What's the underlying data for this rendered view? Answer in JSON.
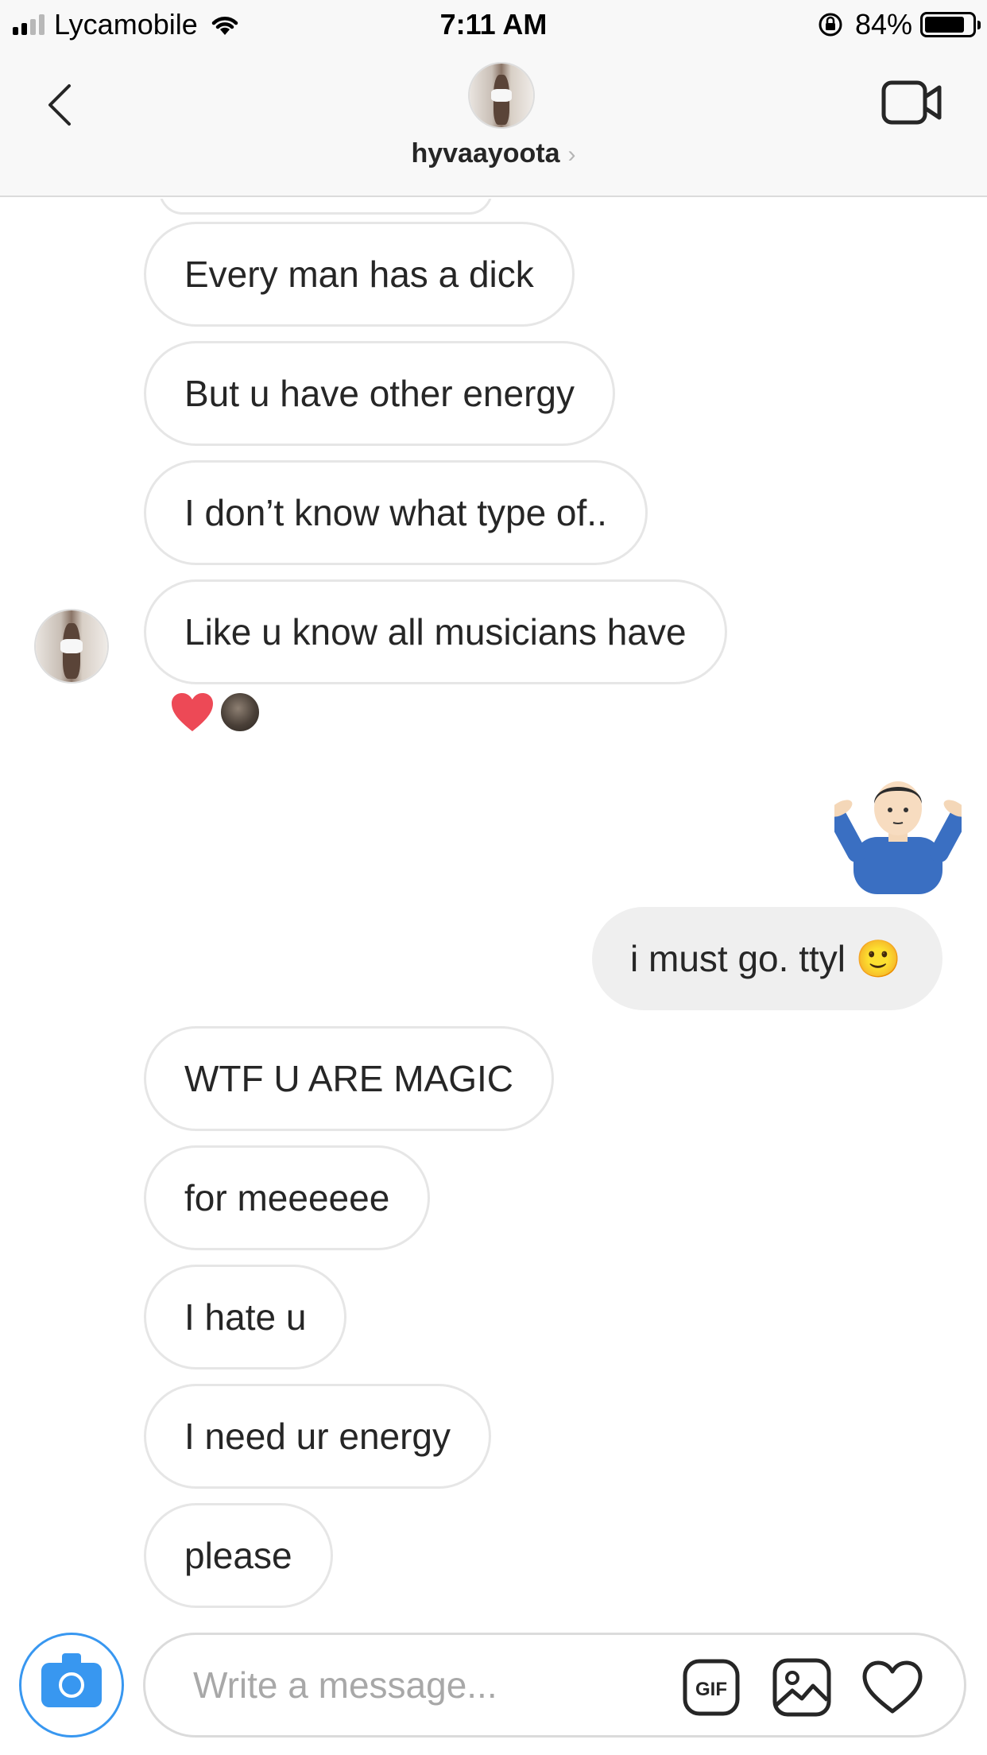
{
  "status_bar": {
    "carrier": "Lycamobile",
    "time": "7:11 AM",
    "battery_percent": "84%",
    "battery_level": 0.84,
    "signal_bars": 2,
    "icons": [
      "signal-icon",
      "wifi-icon",
      "rotation-lock-icon",
      "battery-icon"
    ]
  },
  "header": {
    "username": "hyvaayoota",
    "chevron": "›",
    "icons": [
      "back-icon",
      "video-call-icon"
    ]
  },
  "messages": {
    "m1": "Every man has a dick",
    "m2": "But u have other energy",
    "m3": "I don’t know what type of..",
    "m4": "Like u know all musicians have",
    "m5_emoji": "🤷‍♂️",
    "m6": "i must go. ttyl 🙂",
    "m7": "WTF U ARE MAGIC",
    "m8": "for meeeeee",
    "m9": "I hate u",
    "m10": "I need ur energy",
    "m11": "please"
  },
  "reactions": {
    "emoji": "heart-icon",
    "heart_color": "#ed4956"
  },
  "composer": {
    "placeholder": "Write a message...",
    "gif_label": "GIF",
    "icons": [
      "camera-icon",
      "gif-icon",
      "gallery-icon",
      "heart-outline-icon"
    ],
    "accent": "#3897f0"
  }
}
